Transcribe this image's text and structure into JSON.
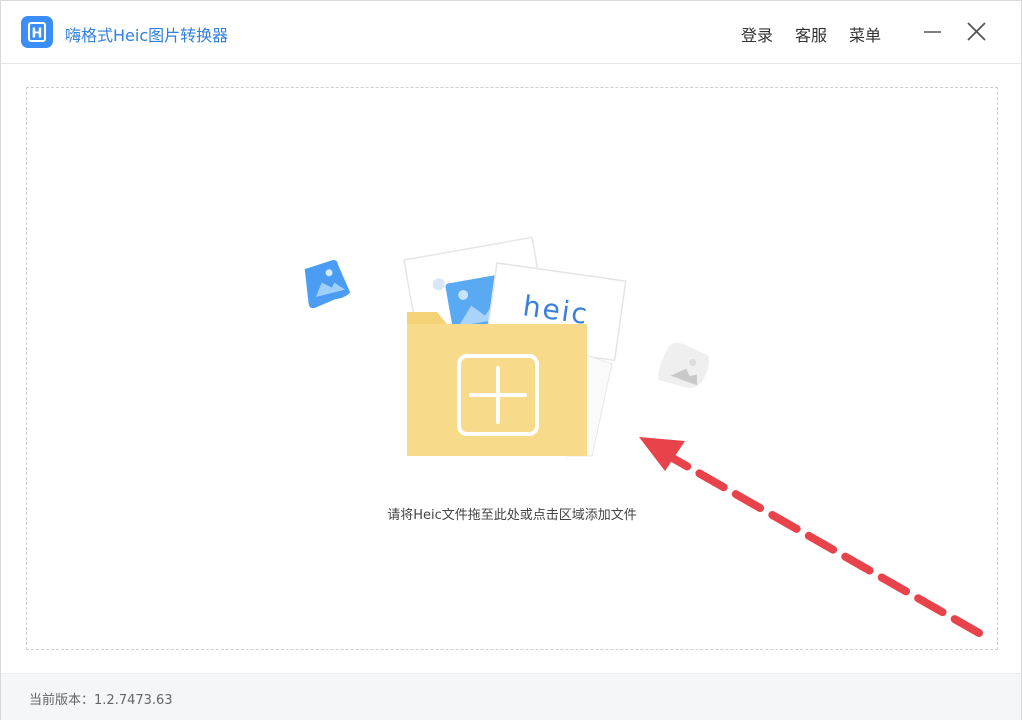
{
  "titlebar": {
    "title": "嗨格式Heic图片转换器",
    "logo_letter": "H",
    "menu": [
      {
        "label": "登录"
      },
      {
        "label": "客服"
      },
      {
        "label": "菜单"
      }
    ],
    "minimize_icon": "minimize-icon",
    "close_icon": "close-icon"
  },
  "drop_zone": {
    "illustration_text": "heic",
    "hint": "请将Heic文件拖至此处或点击区域添加文件"
  },
  "footer": {
    "version_label": "当前版本：",
    "version": "1.2.7473.63"
  },
  "colors": {
    "brand": "#3a8ef6",
    "folder": "#f6d57f",
    "arrow": "#e8424b"
  }
}
